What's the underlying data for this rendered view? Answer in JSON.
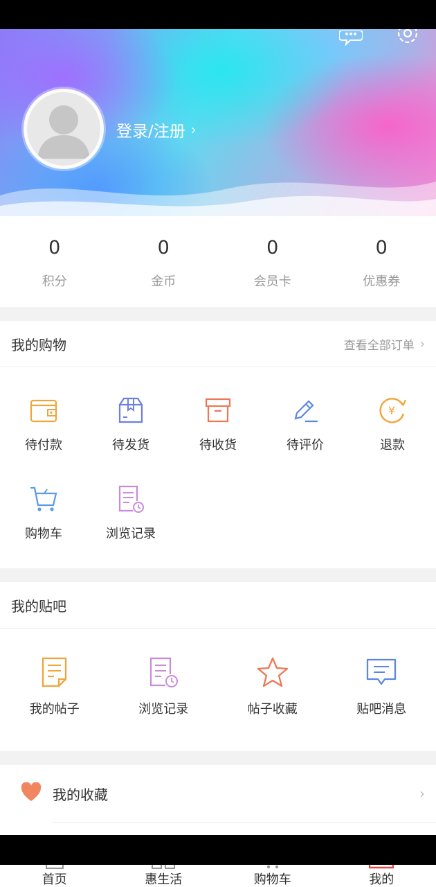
{
  "header": {
    "login_label": "登录/注册",
    "chevron": "›"
  },
  "stats": [
    {
      "value": "0",
      "label": "积分"
    },
    {
      "value": "0",
      "label": "金币"
    },
    {
      "value": "0",
      "label": "会员卡"
    },
    {
      "value": "0",
      "label": "优惠券"
    }
  ],
  "shopping": {
    "title": "我的购物",
    "link": "查看全部订单",
    "items": [
      {
        "label": "待付款",
        "icon": "wallet-icon"
      },
      {
        "label": "待发货",
        "icon": "box-icon"
      },
      {
        "label": "待收货",
        "icon": "package-icon"
      },
      {
        "label": "待评价",
        "icon": "pen-icon"
      },
      {
        "label": "退款",
        "icon": "refund-icon"
      },
      {
        "label": "购物车",
        "icon": "cart-icon"
      },
      {
        "label": "浏览记录",
        "icon": "history-icon"
      }
    ]
  },
  "tieba": {
    "title": "我的贴吧",
    "items": [
      {
        "label": "我的帖子",
        "icon": "post-icon"
      },
      {
        "label": "浏览记录",
        "icon": "history-icon"
      },
      {
        "label": "帖子收藏",
        "icon": "star-icon"
      },
      {
        "label": "贴吧消息",
        "icon": "message-icon"
      }
    ]
  },
  "favorites": {
    "label": "我的收藏",
    "icon": "heart-icon"
  },
  "tabbar": [
    {
      "label": "首页"
    },
    {
      "label": "惠生活"
    },
    {
      "label": "购物车"
    },
    {
      "label": "我的",
      "active": true
    }
  ],
  "colors": {
    "orange": "#f0a53a",
    "purple": "#c98ad8",
    "blue": "#5b87e0",
    "red": "#ee7755",
    "tab_active": "#e44"
  }
}
